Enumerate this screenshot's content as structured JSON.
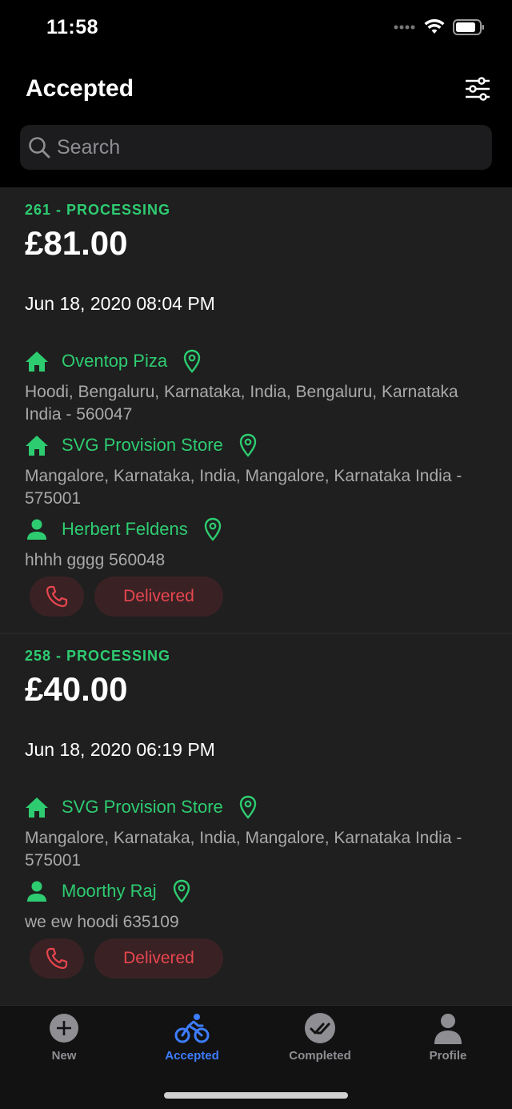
{
  "status_bar": {
    "time": "11:58"
  },
  "header": {
    "title": "Accepted"
  },
  "search": {
    "placeholder": "Search"
  },
  "orders": [
    {
      "status": "261 - PROCESSING",
      "amount": "£81.00",
      "date": "Jun 18, 2020 08:04 PM",
      "stops": [
        {
          "type": "store",
          "name": "Oventop Piza",
          "address": "Hoodi, Bengaluru, Karnataka, India, Bengaluru, Karnataka India - 560047"
        },
        {
          "type": "store",
          "name": "SVG Provision Store",
          "address": "Mangalore, Karnataka, India, Mangalore, Karnataka India - 575001"
        },
        {
          "type": "customer",
          "name": "Herbert Feldens",
          "address": "hhhh gggg 560048"
        }
      ],
      "action_label": "Delivered"
    },
    {
      "status": "258 - PROCESSING",
      "amount": "£40.00",
      "date": "Jun 18, 2020 06:19 PM",
      "stops": [
        {
          "type": "store",
          "name": "SVG Provision Store",
          "address": "Mangalore, Karnataka, India, Mangalore, Karnataka India - 575001"
        },
        {
          "type": "customer",
          "name": "Moorthy Raj",
          "address": "we ew hoodi 635109"
        }
      ],
      "action_label": "Delivered"
    }
  ],
  "tabs": [
    {
      "label": "New",
      "icon": "plus-circle-icon"
    },
    {
      "label": "Accepted",
      "icon": "bicycle-icon",
      "active": true
    },
    {
      "label": "Completed",
      "icon": "double-check-icon"
    },
    {
      "label": "Profile",
      "icon": "person-icon"
    }
  ],
  "colors": {
    "accent_green": "#2ecc71",
    "accent_red": "#e8464f",
    "tab_active": "#3d7dff"
  }
}
